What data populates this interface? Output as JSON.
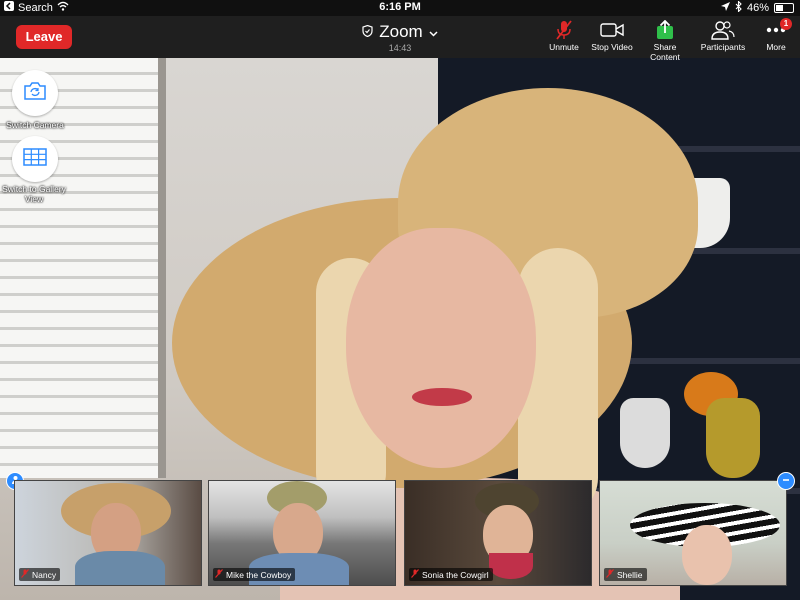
{
  "status_bar": {
    "back_label": "Search",
    "time": "6:16 PM",
    "battery": "46%",
    "battery_level": 0.46,
    "icons": [
      "back-chevron-icon",
      "wifi-icon",
      "location-arrow-icon",
      "bluetooth-icon",
      "battery-icon"
    ]
  },
  "toolbar": {
    "leave_label": "Leave",
    "title": "Zoom",
    "duration": "14:43",
    "buttons": [
      {
        "label": "Unmute",
        "icon": "microphone-muted-icon"
      },
      {
        "label": "Stop Video",
        "icon": "video-camera-icon"
      },
      {
        "label": "Share Content",
        "icon": "share-upload-icon"
      },
      {
        "label": "Participants",
        "icon": "participants-icon"
      },
      {
        "label": "More",
        "icon": "more-dots-icon",
        "badge": "1"
      }
    ],
    "accent_color": "#e02828",
    "share_color": "#2fbf4a"
  },
  "floating": {
    "switch_camera": "Switch Camera",
    "switch_gallery": "Switch to Gallery View"
  },
  "thumbnails": [
    {
      "name": "Nancy",
      "muted": true
    },
    {
      "name": "Mike the Cowboy",
      "muted": true
    },
    {
      "name": "Sonia the Cowgirl",
      "muted": true
    },
    {
      "name": "Shellie",
      "muted": true
    }
  ]
}
